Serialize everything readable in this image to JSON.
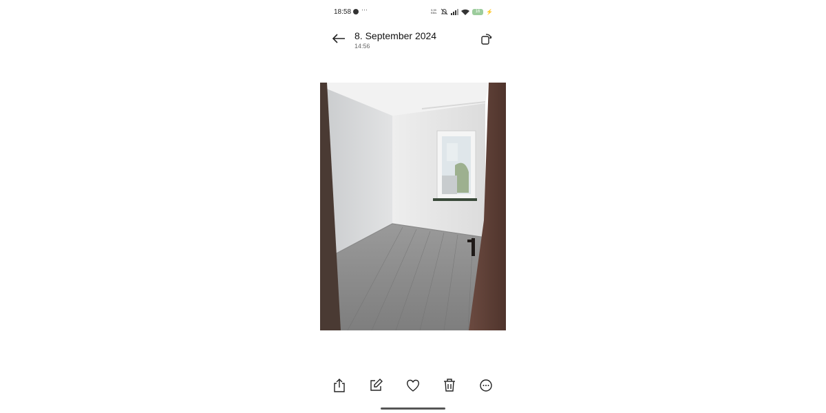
{
  "status_bar": {
    "time": "18:58",
    "more": "···",
    "net_speed_value": "5.99",
    "net_speed_unit": "KB/s",
    "battery": "16",
    "icons": [
      "facebook-icon",
      "mute-icon",
      "signal-icon",
      "wifi-icon",
      "battery-icon",
      "charging-icon"
    ]
  },
  "header": {
    "title": "8. September 2024",
    "subtitle": "14:56"
  },
  "toolbar": {
    "icons": [
      "share-icon",
      "edit-icon",
      "favorite-icon",
      "delete-icon",
      "more-icon"
    ]
  },
  "colors": {
    "background": "#ffffff",
    "icon": "#222222",
    "door": "#5a3d34",
    "floor": "#8c8c8c"
  }
}
